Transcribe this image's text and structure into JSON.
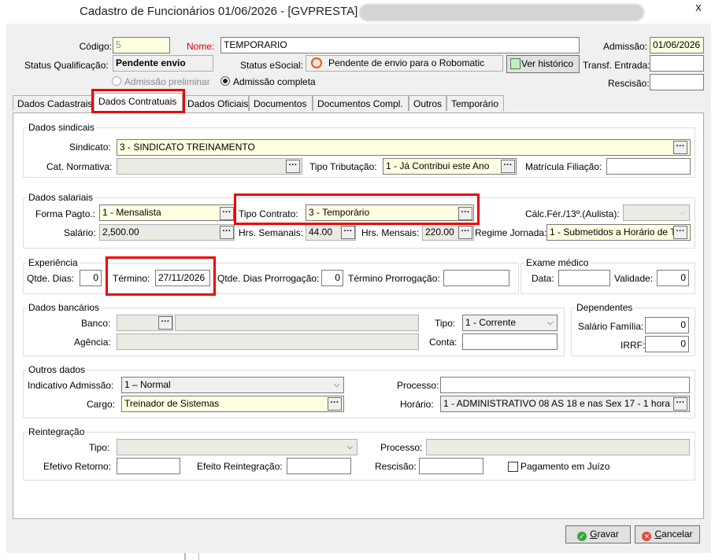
{
  "window": {
    "title": "Cadastro de Funcionários  01/06/2026 - [GVPRESTA] -",
    "close": "x"
  },
  "header": {
    "codigo_label": "Código:",
    "codigo_value": "5",
    "nome_label": "Nome:",
    "nome_value": "TEMPORARIO",
    "admissao_label": "Admissão:",
    "admissao_value": "01/06/2026",
    "status_qualificacao_label": "Status Qualificação:",
    "status_qualificacao_value": "Pendente envio",
    "status_esocial_label": "Status eSocial:",
    "status_esocial_value": "Pendente de envio para o Robomatic",
    "ver_historico": "Ver histórico",
    "transf_entrada_label": "Transf. Entrada:",
    "rescisao_label": "Rescisão:",
    "admissao_preliminar": "Admissão preliminar",
    "admissao_completa": "Admissão completa"
  },
  "tabs": [
    "Dados Cadastrais",
    "Dados Contratuais",
    "Dados Oficiais",
    "Documentos",
    "Documentos Compl.",
    "Outros",
    "Temporário"
  ],
  "sindicais": {
    "title": "Dados sindicais",
    "sindicato_label": "Sindicato:",
    "sindicato_value": "3 - SINDICATO TREINAMENTO",
    "cat_normativa_label": "Cat. Normativa:",
    "tipo_tributacao_label": "Tipo Tributação:",
    "tipo_tributacao_value": "1 - Já Contribui este Ano",
    "matricula_filiacao_label": "Matrícula Filiação:"
  },
  "salariais": {
    "title": "Dados salariais",
    "forma_pagto_label": "Forma Pagto.:",
    "forma_pagto_value": "1 -  Mensalista",
    "tipo_contrato_label": "Tipo Contrato:",
    "tipo_contrato_value": "3 - Temporário",
    "calc_fer_label": "Cálc.Fér./13º.(Aulista):",
    "salario_label": "Salário:",
    "salario_value": "2,500.00",
    "hrs_semanais_label": "Hrs. Semanais:",
    "hrs_semanais_value": "44.00",
    "hrs_mensais_label": "Hrs. Mensais:",
    "hrs_mensais_value": "220.00",
    "regime_jornada_label": "Regime Jornada:",
    "regime_jornada_value": "1 - Submetidos a Horário de T"
  },
  "experiencia": {
    "title": "Experiência",
    "qtde_dias_label": "Qtde. Dias:",
    "qtde_dias_value": "0",
    "termino_label": "Término:",
    "termino_value": "27/11/2026",
    "qtde_prorrogacao_label": "Qtde. Dias Prorrogação:",
    "qtde_prorrogacao_value": "0",
    "termino_prorrogacao_label": "Término Prorrogação:"
  },
  "exame": {
    "title": "Exame médico",
    "data_label": "Data:",
    "validade_label": "Validade:",
    "validade_value": "0"
  },
  "bancarios": {
    "title": "Dados bancários",
    "banco_label": "Banco:",
    "agencia_label": "Agência:",
    "tipo_label": "Tipo:",
    "tipo_value": "1 - Corrente",
    "conta_label": "Conta:"
  },
  "dependentes": {
    "title": "Dependentes",
    "salario_familia_label": "Salário Família:",
    "salario_familia_value": "0",
    "irrf_label": "IRRF:",
    "irrf_value": "0"
  },
  "outros": {
    "title": "Outros dados",
    "indicativo_label": "Indicativo Admissão:",
    "indicativo_value": "1 – Normal",
    "processo_label": "Processo:",
    "cargo_label": "Cargo:",
    "cargo_value": "Treinador de Sistemas",
    "horario_label": "Horário:",
    "horario_value": "1 - ADMINISTRATIVO 08 AS 18 e nas Sex 17 - 1 hora"
  },
  "reintegracao": {
    "title": "Reintegração",
    "tipo_label": "Tipo:",
    "processo_label": "Processo:",
    "efetivo_retorno_label": "Efetivo Retorno:",
    "efeito_reintegracao_label": "Efeito Reintegração:",
    "rescisao_label": "Rescisão:",
    "pagamento_juizo_label": "Pagamento em Juízo"
  },
  "buttons": {
    "gravar_first": "G",
    "gravar_rest": "ravar",
    "cancelar_first": "C",
    "cancelar_rest": "ancelar"
  },
  "colors": {
    "highlight": "#e00000",
    "required_label": "#d00000",
    "yellow_field": "#ffffe1"
  }
}
